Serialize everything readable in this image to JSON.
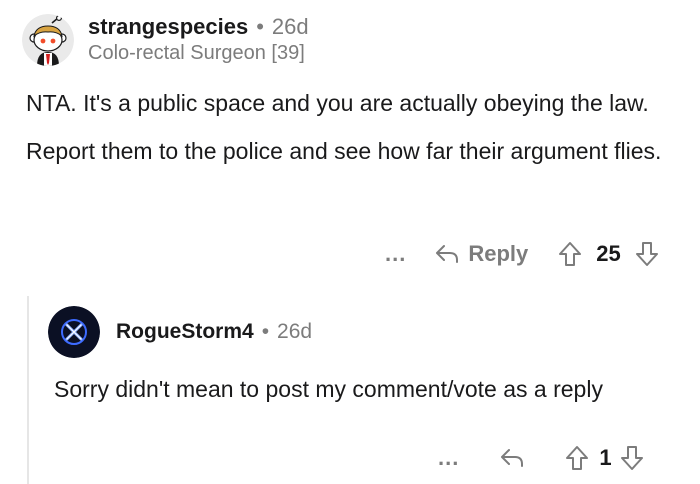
{
  "comment": {
    "username": "strangespecies",
    "separator": "•",
    "age": "26d",
    "flair": "Colo-rectal Surgeon [39]",
    "paragraphs": [
      "NTA. It's a public space and you are actually obeying the law.",
      "Report them to the police and see how far  their argument flies."
    ],
    "actions": {
      "more": "...",
      "reply": "Reply",
      "score": "25"
    }
  },
  "reply": {
    "username": "RogueStorm4",
    "separator": "•",
    "age": "26d",
    "text": "Sorry didn't mean to post my comment/vote as a reply",
    "actions": {
      "more": "...",
      "score": "1"
    }
  },
  "icons": {
    "avatar_1": "reddit-snoo-avatar",
    "avatar_2": "blue-x-logo-avatar",
    "reply": "reply-arrow-icon",
    "upvote": "upvote-arrow-icon",
    "downvote": "downvote-arrow-icon"
  },
  "colors": {
    "text_primary": "#1a1a1b",
    "text_secondary": "#7c7c7c",
    "thread_line": "#e6e6e6",
    "avatar2_bg": "#0b1024",
    "avatar2_accent": "#3d6bff"
  }
}
